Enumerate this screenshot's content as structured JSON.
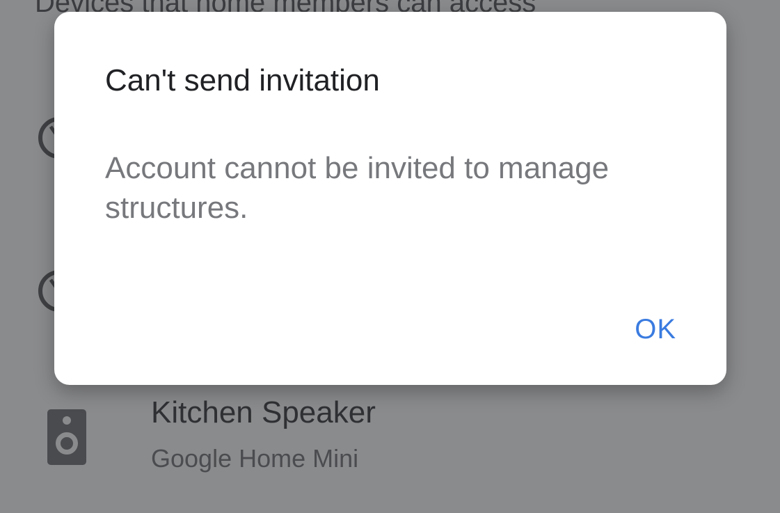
{
  "background": {
    "section_title": "Devices that home members can access",
    "devices": [
      {
        "icon": "blocked-circle-icon"
      },
      {
        "icon": "blocked-circle-icon"
      },
      {
        "icon": "speaker-icon",
        "name": "Kitchen Speaker",
        "type": "Google Home Mini"
      }
    ]
  },
  "dialog": {
    "title": "Can't send invitation",
    "message": "Account cannot be invited to manage structures.",
    "ok_label": "OK",
    "colors": {
      "accent": "#3a7be0",
      "scrim": "#8a8b8d"
    }
  }
}
